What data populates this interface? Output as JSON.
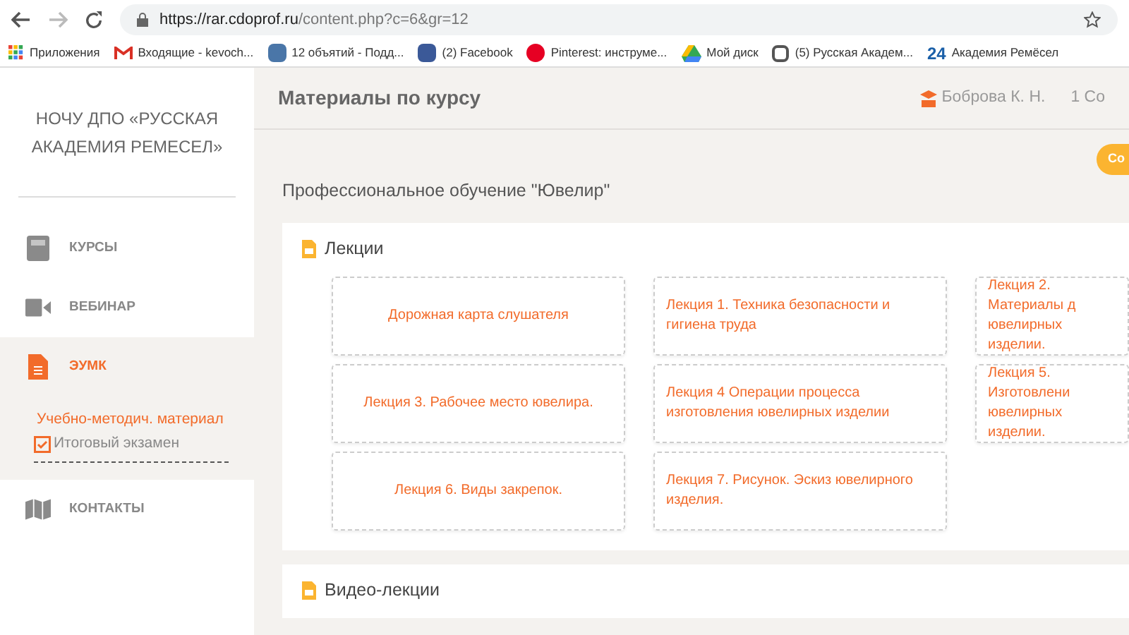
{
  "browser": {
    "url_host": "https://rar.cdoprof.ru",
    "url_path": "/content.php?c=6&gr=12"
  },
  "bookmarks": [
    {
      "kind": "apps",
      "label": "Приложения"
    },
    {
      "kind": "mail",
      "label": "Входящие - kevoch..."
    },
    {
      "kind": "vk",
      "label": "12 объятий - Подд..."
    },
    {
      "kind": "facebook",
      "label": "(2) Facebook"
    },
    {
      "kind": "pinterest",
      "label": "Pinterest: инструме..."
    },
    {
      "kind": "drive",
      "label": "Мой диск"
    },
    {
      "kind": "page",
      "label": "(5) Русская Академ..."
    },
    {
      "kind": "number",
      "label": "Академия Ремёсел",
      "badge": "24"
    }
  ],
  "sidebar": {
    "title": "НОЧУ ДПО «РУССКАЯ АКАДЕМИЯ РЕМЕСЕЛ»",
    "items": [
      {
        "kind": "book",
        "label": "КУРСЫ",
        "selected": false
      },
      {
        "kind": "video",
        "label": "ВЕБИНАР",
        "selected": false
      },
      {
        "kind": "document",
        "label": "ЭУМК",
        "selected": true,
        "children": [
          {
            "kind": "open-book",
            "label": "Учебно-методич. материал",
            "selected": true
          },
          {
            "kind": "checkbox",
            "label": "Итоговый экзамен",
            "selected": false
          }
        ]
      },
      {
        "kind": "map",
        "label": "КОНТАКТЫ",
        "selected": false
      }
    ]
  },
  "header": {
    "title": "Материалы по курсу",
    "user": "Боброва К. Н.",
    "extra": "1 Со"
  },
  "course": {
    "title": "Профессиональное обучение \"Ювелир\"",
    "badge": "Со"
  },
  "sections": [
    {
      "title": "Лекции",
      "items": [
        {
          "label": "Дорожная карта слушателя",
          "kind": "centered"
        },
        {
          "label": "Лекция 1. Техника безопасности и гигиена труда",
          "kind": "lecture"
        },
        {
          "label": "Лекция 2. Материалы д ювелирных изделии.",
          "kind": "lecture"
        },
        {
          "label": "Лекция 3. Рабочее место ювелира.",
          "kind": "centered"
        },
        {
          "label": "Лекция 4 Операции процесса изготовления ювелирных изделии",
          "kind": "lecture"
        },
        {
          "label": "Лекция 5. Изготовлени ювелирных изделии.",
          "kind": "lecture"
        },
        {
          "label": "Лекция 6. Виды закрепок.",
          "kind": "centered"
        },
        {
          "label": "Лекция 7. Рисунок. Эскиз ювелирного изделия.",
          "kind": "lecture"
        }
      ]
    },
    {
      "title": "Видео-лекции"
    }
  ]
}
